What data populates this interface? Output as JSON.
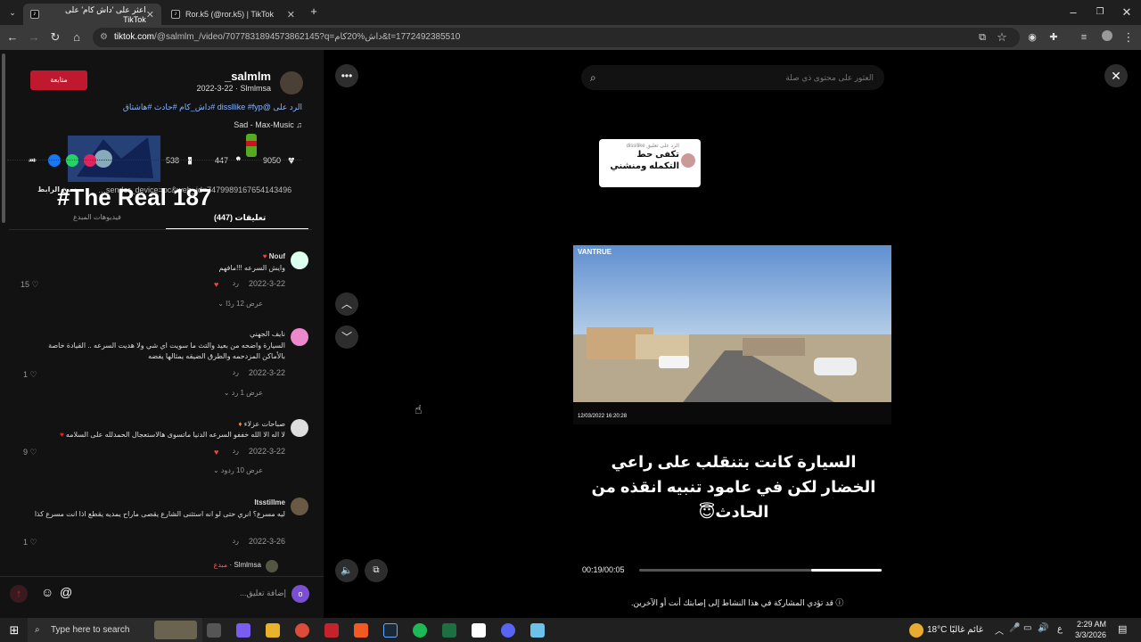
{
  "browser": {
    "tabs": [
      {
        "label": "اعثر على 'داش كام' على TikTok",
        "active": true
      },
      {
        "label": "Ror.k5 (@ror.k5) | TikTok",
        "active": false
      }
    ],
    "new_tab": "+",
    "url_domain": "tiktok.com",
    "url_path": "/@salmlm_/video/7077831894573862145?q=داش%20كام&t=1772492385510"
  },
  "post": {
    "follow_label": "متابعة",
    "username": "salmlm_",
    "date_line": "2022-3-22 · Slmlmsa",
    "description": "الرد على @dissllike #fyp #داش_كام #حادث #هاشتاق",
    "music": "Sad - Max-Music",
    "likes": "9050",
    "comments_count": "447",
    "saves": "538",
    "link_text": "…sender_device=pc&web_id=7479989167654143496",
    "copy_link": "نسخ الرابط",
    "overlay_text": "#The Real 187",
    "tab_comments": "تعليقات (447)",
    "tab_creator": "فيديوهات المبدع"
  },
  "comments": [
    {
      "name": "Nouf",
      "text": "وايش السرعه !!!مافهم",
      "date": "2022-3-22",
      "reply": "رد",
      "likes": "15",
      "view_replies": "عرض 12 ردًا"
    },
    {
      "name": "نايف الجهني",
      "text": "السيارة واضحه من بعيد والتث ما سويت اي شي ولا هديت السرعه .. القيادة خاصة بالأماكن المزدحمه والطرق الضيقه يمثالها يفضه",
      "date": "2022-3-22",
      "reply": "رد",
      "likes": "1",
      "view_replies": "عرض 1 رد"
    },
    {
      "name": "صباحات عزلاء",
      "text": "لا اله الا الله خففو السرعه الدنيا ماتسوى هالاستعجال الحمدلله على السلامه",
      "date": "2022-3-22",
      "reply": "رد",
      "likes": "9",
      "view_replies": "عرض 10 ردود"
    },
    {
      "name": "Itsstillme",
      "text": "ليه مسرع؟ انري حتى لو انه استثنى الشارع يقصى ماراح يمديه يقطع اذا انت مسرع كذا",
      "date": "2022-3-26",
      "reply": "رد",
      "likes": "1",
      "view_replies": ""
    }
  ],
  "creator_reply": {
    "name": "Slmlmsa",
    "badge": "مبدع"
  },
  "comment_input_placeholder": "إضافة تعليق...",
  "video": {
    "search_placeholder": "العثور على محتوى ذي صلة",
    "reply_bubble_header": "الرد على تعليق dissllike",
    "reply_bubble_text": "تكفى حط التكمله ومنشني",
    "watermark": "VANTRUE",
    "timestamp_overlay": "12/03/2022 16:20:28",
    "caption": "السيارة كانت بتنقلب على راعي الخضار لكن في عامود تنبيه انقذه من الحادث😇",
    "time": "00:19/00:05",
    "progress": 0.29,
    "warning": "قد تؤدي المشاركة في هذا النشاط إلى إصابتك أنت أو الآخرين."
  },
  "taskbar": {
    "search_placeholder": "Type here to search",
    "weather": "18°C  غائم غالبًا",
    "lang": "ع",
    "time": "2:29 AM",
    "date": "3/3/2026"
  }
}
